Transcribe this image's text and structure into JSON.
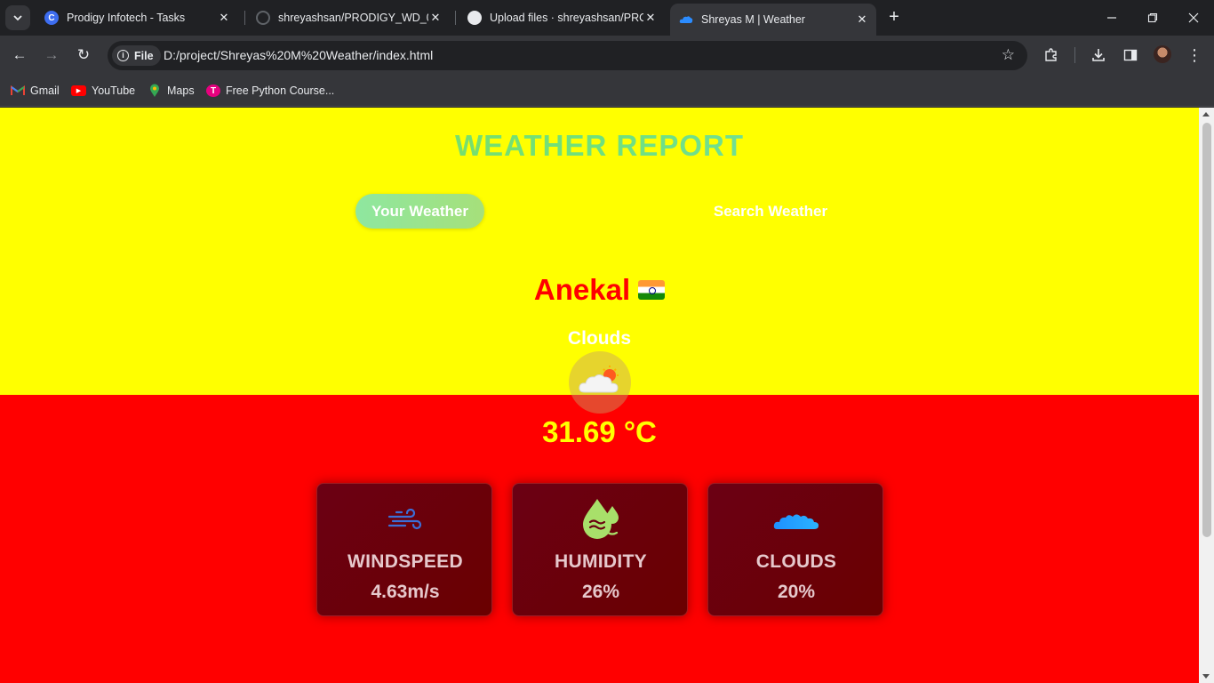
{
  "browser": {
    "tabs": [
      {
        "title": "Prodigy Infotech - Tasks",
        "active": false
      },
      {
        "title": "shreyashsan/PRODIGY_WD_04",
        "active": false
      },
      {
        "title": "Upload files · shreyashsan/PRODIGY_WD_04",
        "active": false
      },
      {
        "title": "Shreyas M | Weather",
        "active": true
      }
    ],
    "address_chip": "File",
    "url": "D:/project/Shreyas%20M%20Weather/index.html",
    "bookmarks": [
      {
        "label": "Gmail"
      },
      {
        "label": "YouTube"
      },
      {
        "label": "Maps"
      },
      {
        "label": "Free Python Course..."
      }
    ]
  },
  "page": {
    "title": "WEATHER REPORT",
    "tabs": {
      "your_weather": "Your Weather",
      "search_weather": "Search Weather"
    },
    "city": "Anekal",
    "country_flag": "india-flag",
    "description": "Clouds",
    "weather_icon": "partly-cloudy-sun-icon",
    "temperature": "31.69 °C",
    "cards": [
      {
        "label": "WINDSPEED",
        "value": "4.63m/s",
        "icon": "wind-icon"
      },
      {
        "label": "HUMIDITY",
        "value": "26%",
        "icon": "humidity-drop-icon"
      },
      {
        "label": "CLOUDS",
        "value": "20%",
        "icon": "cloud-icon"
      }
    ]
  },
  "colors": {
    "top_background": "#ffff00",
    "bottom_background": "#ff0000",
    "city_text": "#ff0000",
    "temperature_text": "#ffff00"
  }
}
